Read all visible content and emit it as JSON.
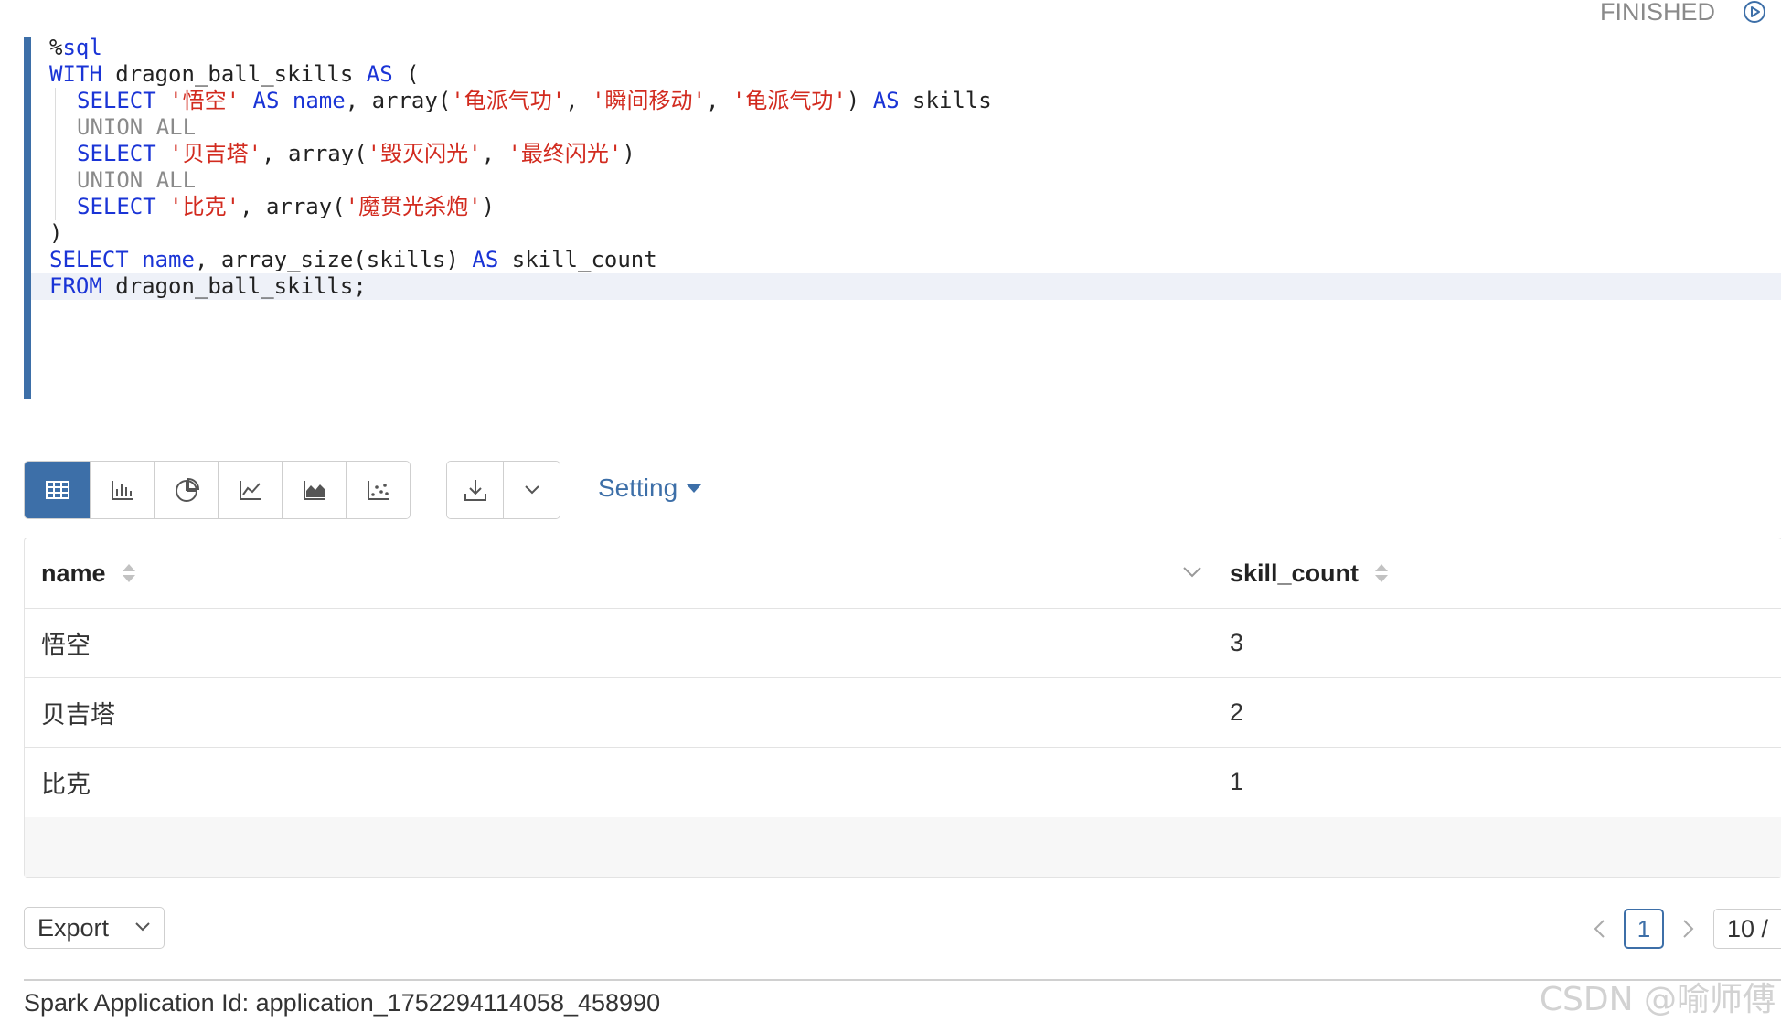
{
  "paragraph": {
    "status": "FINISHED"
  },
  "editor": {
    "lines": [
      [
        {
          "t": "%",
          "c": "pl"
        },
        {
          "t": "sql",
          "c": "kw"
        }
      ],
      [
        {
          "t": "WITH",
          "c": "kw"
        },
        {
          "t": " dragon_ball_skills ",
          "c": "pl"
        },
        {
          "t": "AS",
          "c": "kw"
        },
        {
          "t": " (",
          "c": "pl"
        }
      ],
      [
        {
          "t": "SELECT",
          "c": "kw"
        },
        {
          "t": " ",
          "c": "pl"
        },
        {
          "t": "'悟空'",
          "c": "str"
        },
        {
          "t": " ",
          "c": "pl"
        },
        {
          "t": "AS",
          "c": "kw"
        },
        {
          "t": " ",
          "c": "pl"
        },
        {
          "t": "name",
          "c": "kw"
        },
        {
          "t": ", array(",
          "c": "pl"
        },
        {
          "t": "'龟派气功'",
          "c": "str"
        },
        {
          "t": ", ",
          "c": "pl"
        },
        {
          "t": "'瞬间移动'",
          "c": "str"
        },
        {
          "t": ", ",
          "c": "pl"
        },
        {
          "t": "'龟派气功'",
          "c": "str"
        },
        {
          "t": ") ",
          "c": "pl"
        },
        {
          "t": "AS",
          "c": "kw"
        },
        {
          "t": " skills",
          "c": "pl"
        }
      ],
      [
        {
          "t": "UNION ALL",
          "c": "kw-d"
        }
      ],
      [
        {
          "t": "SELECT",
          "c": "kw"
        },
        {
          "t": " ",
          "c": "pl"
        },
        {
          "t": "'贝吉塔'",
          "c": "str"
        },
        {
          "t": ", array(",
          "c": "pl"
        },
        {
          "t": "'毁灭闪光'",
          "c": "str"
        },
        {
          "t": ", ",
          "c": "pl"
        },
        {
          "t": "'最终闪光'",
          "c": "str"
        },
        {
          "t": ")",
          "c": "pl"
        }
      ],
      [
        {
          "t": "UNION ALL",
          "c": "kw-d"
        }
      ],
      [
        {
          "t": "SELECT",
          "c": "kw"
        },
        {
          "t": " ",
          "c": "pl"
        },
        {
          "t": "'比克'",
          "c": "str"
        },
        {
          "t": ", array(",
          "c": "pl"
        },
        {
          "t": "'魔贯光杀炮'",
          "c": "str"
        },
        {
          "t": ")",
          "c": "pl"
        }
      ],
      [
        {
          "t": ")",
          "c": "pl"
        }
      ],
      [
        {
          "t": "SELECT",
          "c": "kw"
        },
        {
          "t": " ",
          "c": "pl"
        },
        {
          "t": "name",
          "c": "kw"
        },
        {
          "t": ", array_size(skills) ",
          "c": "pl"
        },
        {
          "t": "AS",
          "c": "kw"
        },
        {
          "t": " skill_count",
          "c": "pl"
        }
      ],
      [
        {
          "t": "FROM",
          "c": "kw"
        },
        {
          "t": " dragon_ball_skills;",
          "c": "pl"
        }
      ]
    ]
  },
  "toolbar": {
    "viz_buttons": [
      "table-icon",
      "bar-chart-icon",
      "pie-chart-icon",
      "line-chart-icon",
      "area-chart-icon",
      "scatter-chart-icon"
    ],
    "active_viz": "table-icon",
    "setting_label": "Setting"
  },
  "table": {
    "columns": [
      "name",
      "skill_count"
    ],
    "rows": [
      [
        "悟空",
        "3"
      ],
      [
        "贝吉塔",
        "2"
      ],
      [
        "比克",
        "1"
      ]
    ]
  },
  "footer": {
    "export_label": "Export",
    "current_page": "1",
    "page_size": "10 /",
    "app_id": "Spark Application Id: application_1752294114058_458990",
    "watermark": "CSDN @喻师傅"
  },
  "colors": {
    "accent": "#3d6fa8",
    "keyword": "#1a34d6",
    "string": "#d22b1f"
  }
}
